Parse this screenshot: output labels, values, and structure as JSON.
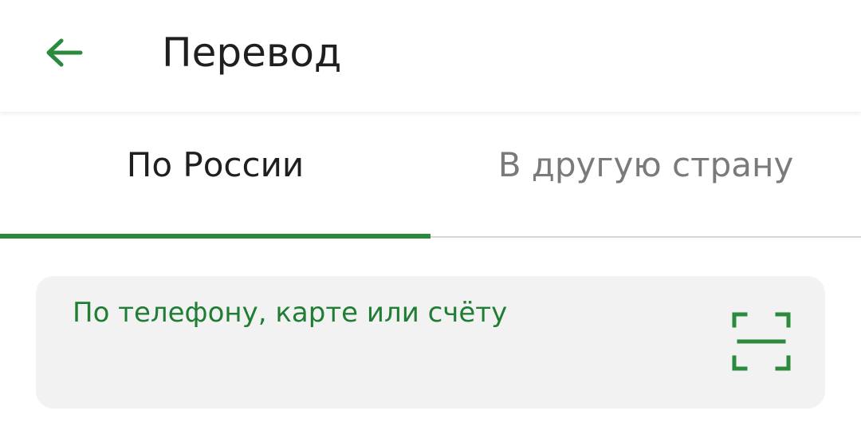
{
  "colors": {
    "accent": "#2b8a3e",
    "placeholder": "#1f7d34",
    "title_text": "#1f1f1f",
    "inactive_tab": "#7a7a7a",
    "card_bg": "#f2f2f2"
  },
  "header": {
    "title": "Перевод",
    "back_icon": "arrow-left-icon"
  },
  "tabs": [
    {
      "label": "По России",
      "active": true
    },
    {
      "label": "В другую страну",
      "active": false
    }
  ],
  "search": {
    "placeholder": "По телефону, карте или счёту",
    "scan_icon": "scan-icon"
  }
}
